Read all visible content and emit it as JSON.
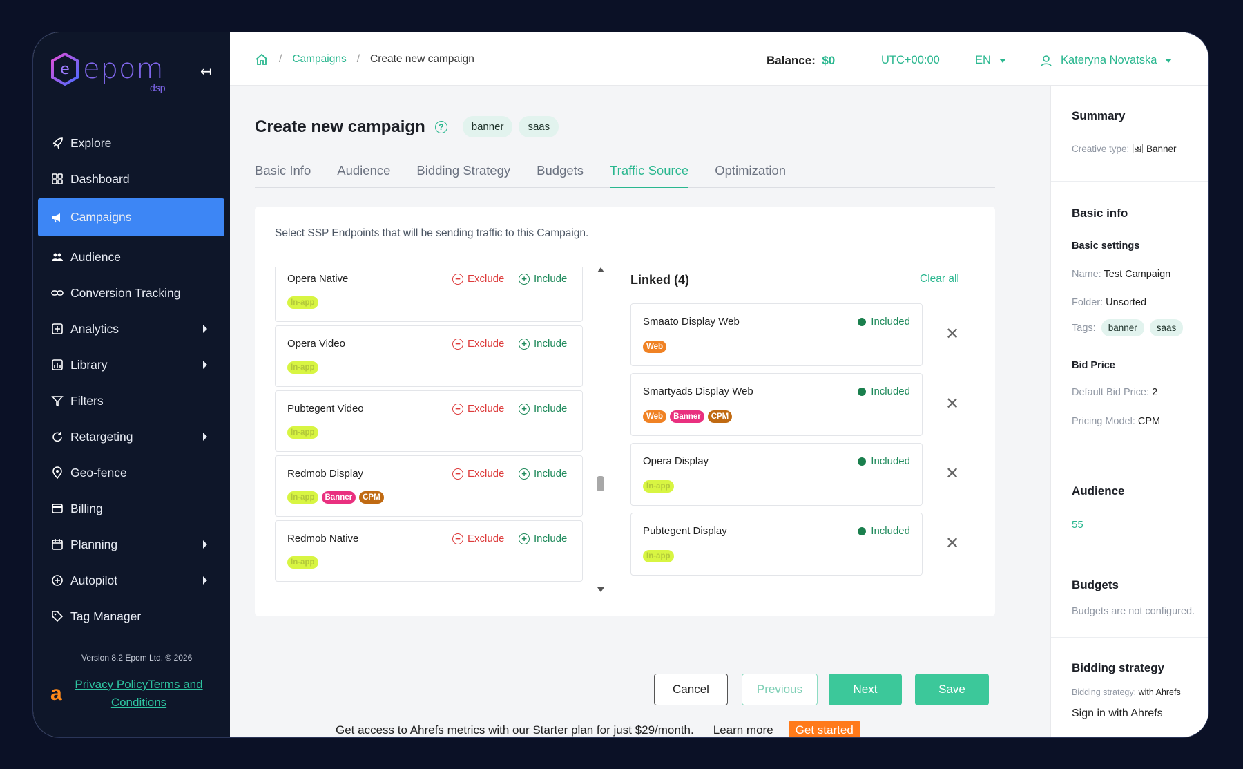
{
  "app": {
    "logo_text": "epom",
    "logo_sub": "dsp",
    "version": "Version 8.2 Epom Ltd. © 2026",
    "privacy": "Privacy PolicyTerms and Conditions",
    "ahrefs_mark": "a"
  },
  "nav": [
    {
      "label": "Explore",
      "icon": "rocket-icon",
      "arrow": false,
      "active": false
    },
    {
      "label": "Dashboard",
      "icon": "grid-icon",
      "arrow": false,
      "active": false
    },
    {
      "label": "Campaigns",
      "icon": "megaphone-icon",
      "arrow": false,
      "active": true
    },
    {
      "label": "Audience",
      "icon": "people-icon",
      "arrow": false,
      "active": false
    },
    {
      "label": "Conversion Tracking",
      "icon": "link-icon",
      "arrow": false,
      "active": false
    },
    {
      "label": "Analytics",
      "icon": "plus-square-icon",
      "arrow": true,
      "active": false
    },
    {
      "label": "Library",
      "icon": "image-icon",
      "arrow": true,
      "active": false
    },
    {
      "label": "Filters",
      "icon": "filter-icon",
      "arrow": false,
      "active": false
    },
    {
      "label": "Retargeting",
      "icon": "refresh-icon",
      "arrow": true,
      "active": false
    },
    {
      "label": "Geo-fence",
      "icon": "pin-icon",
      "arrow": false,
      "active": false
    },
    {
      "label": "Billing",
      "icon": "card-icon",
      "arrow": false,
      "active": false
    },
    {
      "label": "Planning",
      "icon": "calendar-icon",
      "arrow": true,
      "active": false
    },
    {
      "label": "Autopilot",
      "icon": "plus-circle-icon",
      "arrow": true,
      "active": false
    },
    {
      "label": "Tag Manager",
      "icon": "tag-icon",
      "arrow": false,
      "active": false
    }
  ],
  "header": {
    "crumb_campaigns": "Campaigns",
    "crumb_current": "Create new campaign",
    "balance_label": "Balance:",
    "balance_value": "$0",
    "timezone": "UTC+00:00",
    "lang": "EN",
    "user": "Kateryna Novatska"
  },
  "page": {
    "title": "Create new campaign",
    "tags": [
      "banner",
      "saas"
    ],
    "tabs": [
      "Basic Info",
      "Audience",
      "Bidding Strategy",
      "Budgets",
      "Traffic Source",
      "Optimization"
    ],
    "active_tab": 4,
    "instruction": "Select SSP Endpoints that will be sending traffic to this Campaign."
  },
  "actions": {
    "exclude": "Exclude",
    "include": "Include"
  },
  "available": [
    {
      "name": "Opera Native",
      "badges": [
        "In-app"
      ]
    },
    {
      "name": "Opera Video",
      "badges": [
        "In-app"
      ]
    },
    {
      "name": "Pubtegent Video",
      "badges": [
        "In-app"
      ]
    },
    {
      "name": "Redmob Display",
      "badges": [
        "In-app",
        "Banner",
        "CPM"
      ]
    },
    {
      "name": "Redmob Native",
      "badges": [
        "In-app"
      ]
    }
  ],
  "linked": {
    "title": "Linked (4)",
    "clear": "Clear all",
    "status": "Included",
    "items": [
      {
        "name": "Smaato Display Web",
        "badges": [
          "Web"
        ]
      },
      {
        "name": "Smartyads Display Web",
        "badges": [
          "Web",
          "Banner",
          "CPM"
        ]
      },
      {
        "name": "Opera Display",
        "badges": [
          "In-app"
        ]
      },
      {
        "name": "Pubtegent Display",
        "badges": [
          "In-app"
        ]
      }
    ]
  },
  "buttons": {
    "cancel": "Cancel",
    "previous": "Previous",
    "next": "Next",
    "save": "Save"
  },
  "promo": {
    "text": "Get access to Ahrefs metrics with our Starter plan for just $29/month.",
    "learn": "Learn more",
    "cta": "Get started"
  },
  "summary": {
    "title": "Summary",
    "creative_label": "Creative type:",
    "creative_value": "Banner",
    "basic_title": "Basic info",
    "basic_settings": "Basic settings",
    "name_label": "Name:",
    "name_value": "Test Campaign",
    "folder_label": "Folder:",
    "folder_value": "Unsorted",
    "tags_label": "Tags:",
    "tags": [
      "banner",
      "saas"
    ],
    "bid_title": "Bid Price",
    "bid_label": "Default Bid Price:",
    "bid_value": "2",
    "pricing_label": "Pricing Model:",
    "pricing_value": "CPM",
    "audience_title": "Audience",
    "audience_value": "55",
    "budgets_title": "Budgets",
    "budgets_text": "Budgets are not configured.",
    "bidding_title": "Bidding strategy",
    "bidding_label": "Bidding strategy:",
    "bidding_value": "with Ahrefs",
    "signin": "Sign in with Ahrefs"
  },
  "colors": {
    "accent": "#2ab78f",
    "active_nav": "#3d86f5",
    "brand": "#7f66ea",
    "exclude": "#dd3b3b",
    "include": "#1f8a5b"
  }
}
